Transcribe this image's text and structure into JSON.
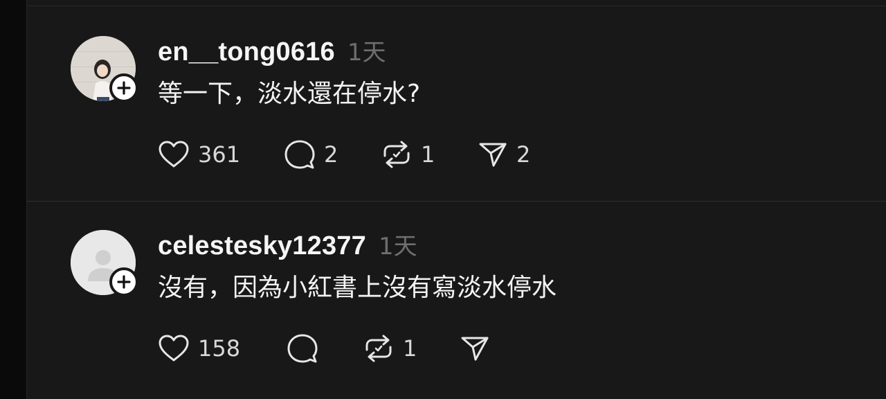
{
  "threads": [
    {
      "username": "en__tong0616",
      "timestamp": "1天",
      "content": "等一下，淡水還在停水?",
      "likes": "361",
      "replies": "2",
      "reposts": "1",
      "shares": "2"
    },
    {
      "username": "celestesky12377",
      "timestamp": "1天",
      "content": "沒有，因為小紅書上沒有寫淡水停水",
      "likes": "158",
      "replies": "",
      "reposts": "1",
      "shares": ""
    }
  ],
  "icons": {
    "like": "heart-icon",
    "reply": "speech-bubble-icon",
    "repost": "repost-arrows-icon",
    "share": "paper-plane-icon",
    "follow": "plus-icon"
  },
  "colors": {
    "background": "#181818",
    "text_primary": "#f3f3f3",
    "text_muted": "#6e6e6e",
    "divider": "#2f2f2f"
  }
}
